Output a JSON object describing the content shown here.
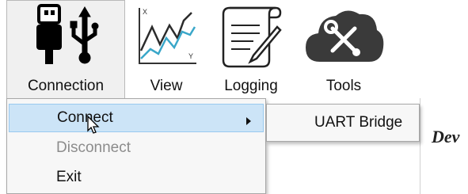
{
  "toolbar": {
    "buttons": [
      {
        "label": "Connection",
        "icon": "usb-icon"
      },
      {
        "label": "View",
        "icon": "chart-icon"
      },
      {
        "label": "Logging",
        "icon": "document-pen-icon"
      },
      {
        "label": "Tools",
        "icon": "tools-cloud-icon"
      }
    ]
  },
  "menu": {
    "items": [
      {
        "label": "Connect",
        "has_submenu": true,
        "highlighted": true
      },
      {
        "label": "Disconnect",
        "disabled": true
      },
      {
        "label": "Exit"
      }
    ]
  },
  "submenu": {
    "items": [
      {
        "label": "UART Bridge"
      }
    ]
  },
  "background": {
    "fragment_text": "Dev"
  },
  "colors": {
    "highlight": "#cce4f7",
    "highlight_border": "#99c9ef",
    "disabled_text": "#8c8c8c"
  }
}
